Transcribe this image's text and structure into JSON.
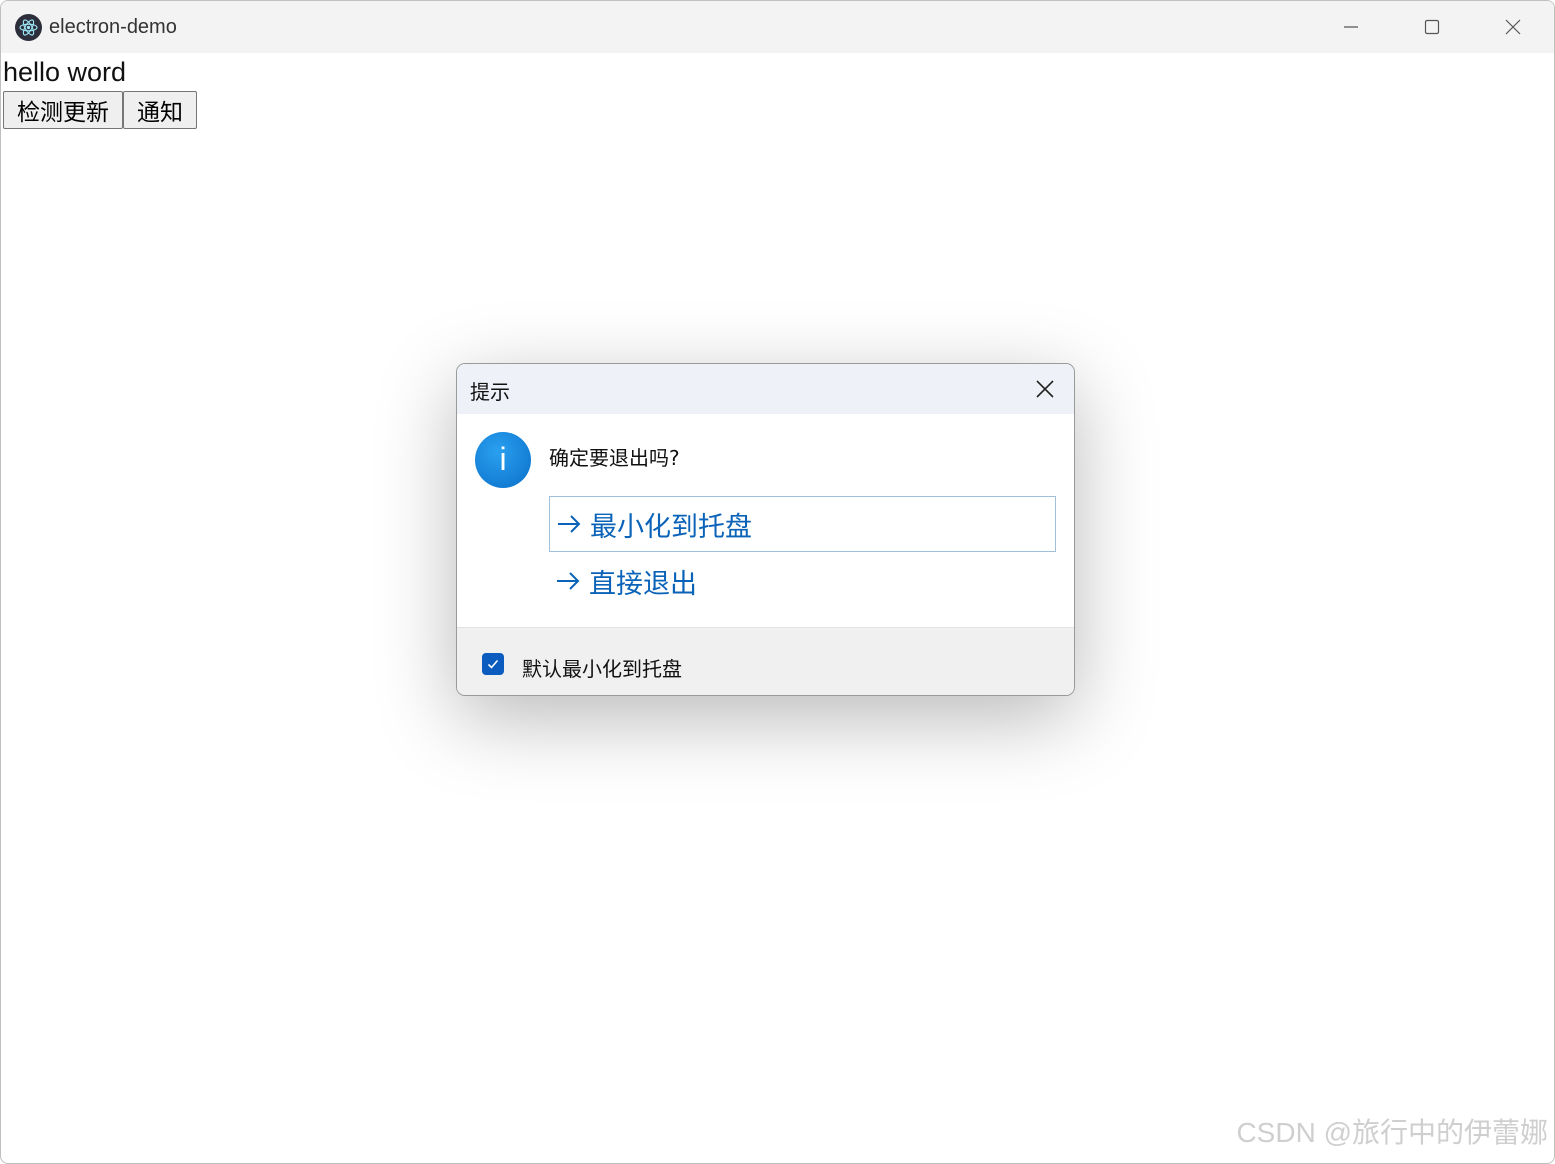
{
  "window": {
    "title": "electron-demo",
    "controls": [
      "minimize",
      "maximize",
      "close"
    ]
  },
  "content": {
    "heading": "hello word",
    "buttons": [
      {
        "label": "检测更新"
      },
      {
        "label": "通知"
      }
    ]
  },
  "dialog": {
    "title": "提示",
    "message": "确定要退出吗?",
    "options": [
      {
        "label": "最小化到托盘",
        "focused": true
      },
      {
        "label": "直接退出",
        "focused": false
      }
    ],
    "checkbox": {
      "label": "默认最小化到托盘",
      "checked": true
    }
  },
  "watermark": "CSDN @旅行中的伊蕾娜",
  "colors": {
    "accent": "#0a63b8",
    "checkbox": "#0b5cbe",
    "titlebar": "#f3f3f3",
    "dialog_header": "#eef2f8"
  }
}
